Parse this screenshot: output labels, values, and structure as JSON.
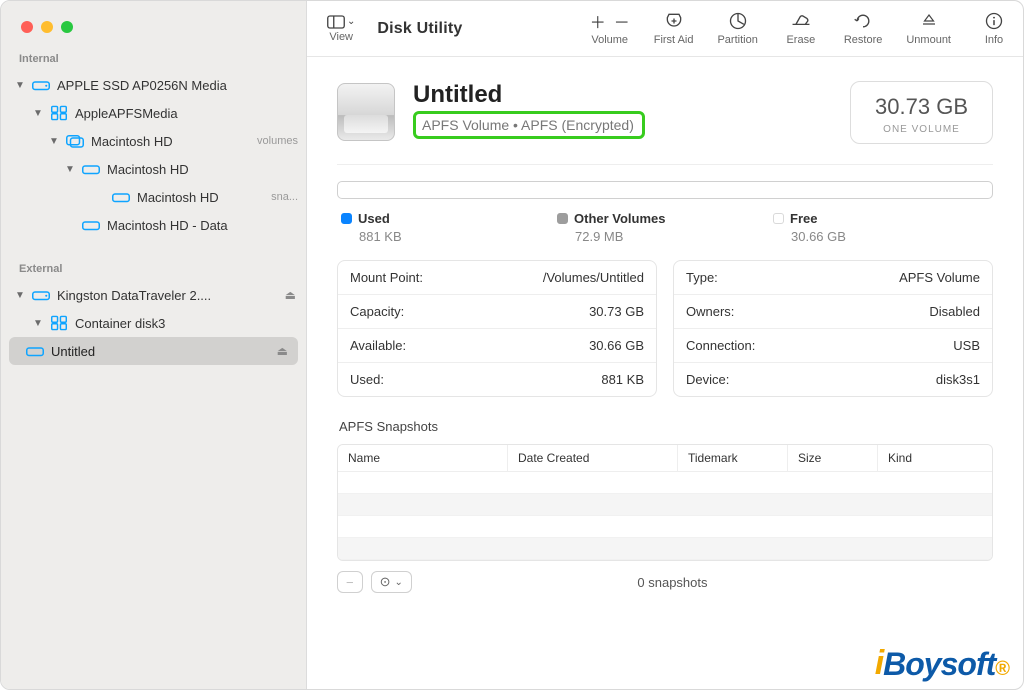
{
  "app": {
    "title": "Disk Utility"
  },
  "toolbar": {
    "view_label": "View",
    "items": {
      "volume": "Volume",
      "first_aid": "First Aid",
      "partition": "Partition",
      "erase": "Erase",
      "restore": "Restore",
      "unmount": "Unmount",
      "info": "Info"
    }
  },
  "sidebar": {
    "sections": {
      "internal": "Internal",
      "external": "External"
    },
    "internal": {
      "ssd": "APPLE SSD AP0256N Media",
      "apfsmedia": "AppleAPFSMedia",
      "machd_container": "Macintosh HD",
      "machd_container_aux": "volumes",
      "machd": "Macintosh HD",
      "machd_snap": "Macintosh HD",
      "machd_snap_aux": "sna...",
      "machd_data": "Macintosh HD - Data"
    },
    "external": {
      "kingston": "Kingston DataTraveler 2....",
      "container": "Container disk3",
      "untitled": "Untitled"
    }
  },
  "volume": {
    "title": "Untitled",
    "subtitle": "APFS Volume • APFS (Encrypted)",
    "size": "30.73 GB",
    "size_caption": "ONE VOLUME"
  },
  "usage": {
    "used": {
      "label": "Used",
      "value": "881 KB"
    },
    "other": {
      "label": "Other Volumes",
      "value": "72.9 MB"
    },
    "free": {
      "label": "Free",
      "value": "30.66 GB"
    }
  },
  "facts_left": [
    {
      "k": "Mount Point:",
      "v": "/Volumes/Untitled"
    },
    {
      "k": "Capacity:",
      "v": "30.73 GB"
    },
    {
      "k": "Available:",
      "v": "30.66 GB"
    },
    {
      "k": "Used:",
      "v": "881 KB"
    }
  ],
  "facts_right": [
    {
      "k": "Type:",
      "v": "APFS Volume"
    },
    {
      "k": "Owners:",
      "v": "Disabled"
    },
    {
      "k": "Connection:",
      "v": "USB"
    },
    {
      "k": "Device:",
      "v": "disk3s1"
    }
  ],
  "snapshots": {
    "title": "APFS Snapshots",
    "headers": [
      "Name",
      "Date Created",
      "Tidemark",
      "Size",
      "Kind"
    ],
    "count": "0 snapshots"
  },
  "logo_text": "Boysoft"
}
